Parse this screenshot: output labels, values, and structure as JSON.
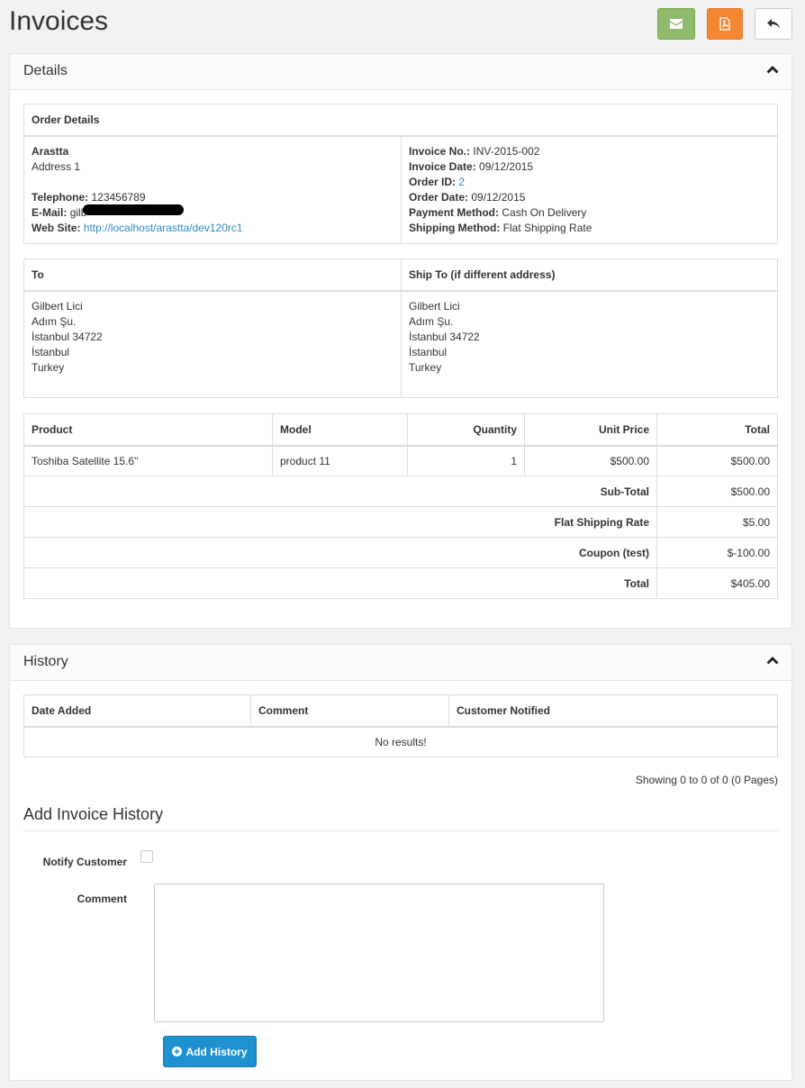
{
  "page": {
    "title": "Invoices",
    "buttons": [
      {
        "name": "email-button",
        "icon": "envelope-icon"
      },
      {
        "name": "pdf-button",
        "icon": "pdf-file-icon"
      },
      {
        "name": "back-button",
        "icon": "reply-icon"
      }
    ]
  },
  "details": {
    "panel_title": "Details",
    "order_details_header": "Order Details",
    "store": {
      "name": "Arastta",
      "address": "Address 1",
      "telephone_label": "Telephone:",
      "telephone": "123456789",
      "email_label": "E-Mail:",
      "email": "gilb",
      "website_label": "Web Site:",
      "website": "http://localhost/arastta/dev120rc1"
    },
    "invoice": {
      "invoice_no_label": "Invoice No.:",
      "invoice_no": "INV-2015-002",
      "invoice_date_label": "Invoice Date:",
      "invoice_date": "09/12/2015",
      "order_id_label": "Order ID:",
      "order_id": "2",
      "order_date_label": "Order Date:",
      "order_date": "09/12/2015",
      "payment_method_label": "Payment Method:",
      "payment_method": "Cash On Delivery",
      "shipping_method_label": "Shipping Method:",
      "shipping_method": "Flat Shipping Rate"
    },
    "to_header": "To",
    "ship_to_header": "Ship To (if different address)",
    "to_address": [
      "Gilbert Lici",
      "Adım Şu.",
      "İstanbul 34722",
      "İstanbul",
      "Turkey"
    ],
    "ship_address": [
      "Gilbert Lici",
      "Adım Şu.",
      "İstanbul 34722",
      "İstanbul",
      "Turkey"
    ],
    "products_columns": [
      "Product",
      "Model",
      "Quantity",
      "Unit Price",
      "Total"
    ],
    "products": [
      {
        "product": "Toshiba Satellite 15.6\"",
        "model": "product 11",
        "quantity": "1",
        "unit_price": "$500.00",
        "total": "$500.00"
      }
    ],
    "totals": [
      {
        "label": "Sub-Total",
        "value": "$500.00"
      },
      {
        "label": "Flat Shipping Rate",
        "value": "$5.00"
      },
      {
        "label": "Coupon (test)",
        "value": "$-100.00"
      },
      {
        "label": "Total",
        "value": "$405.00"
      }
    ]
  },
  "history": {
    "panel_title": "History",
    "columns": [
      "Date Added",
      "Comment",
      "Customer Notified"
    ],
    "empty_text": "No results!",
    "pagination_text": "Showing 0 to 0 of 0 (0 Pages)",
    "add_title": "Add Invoice History",
    "notify_label": "Notify Customer",
    "comment_label": "Comment",
    "comment_value": "",
    "add_button_label": "Add History"
  }
}
